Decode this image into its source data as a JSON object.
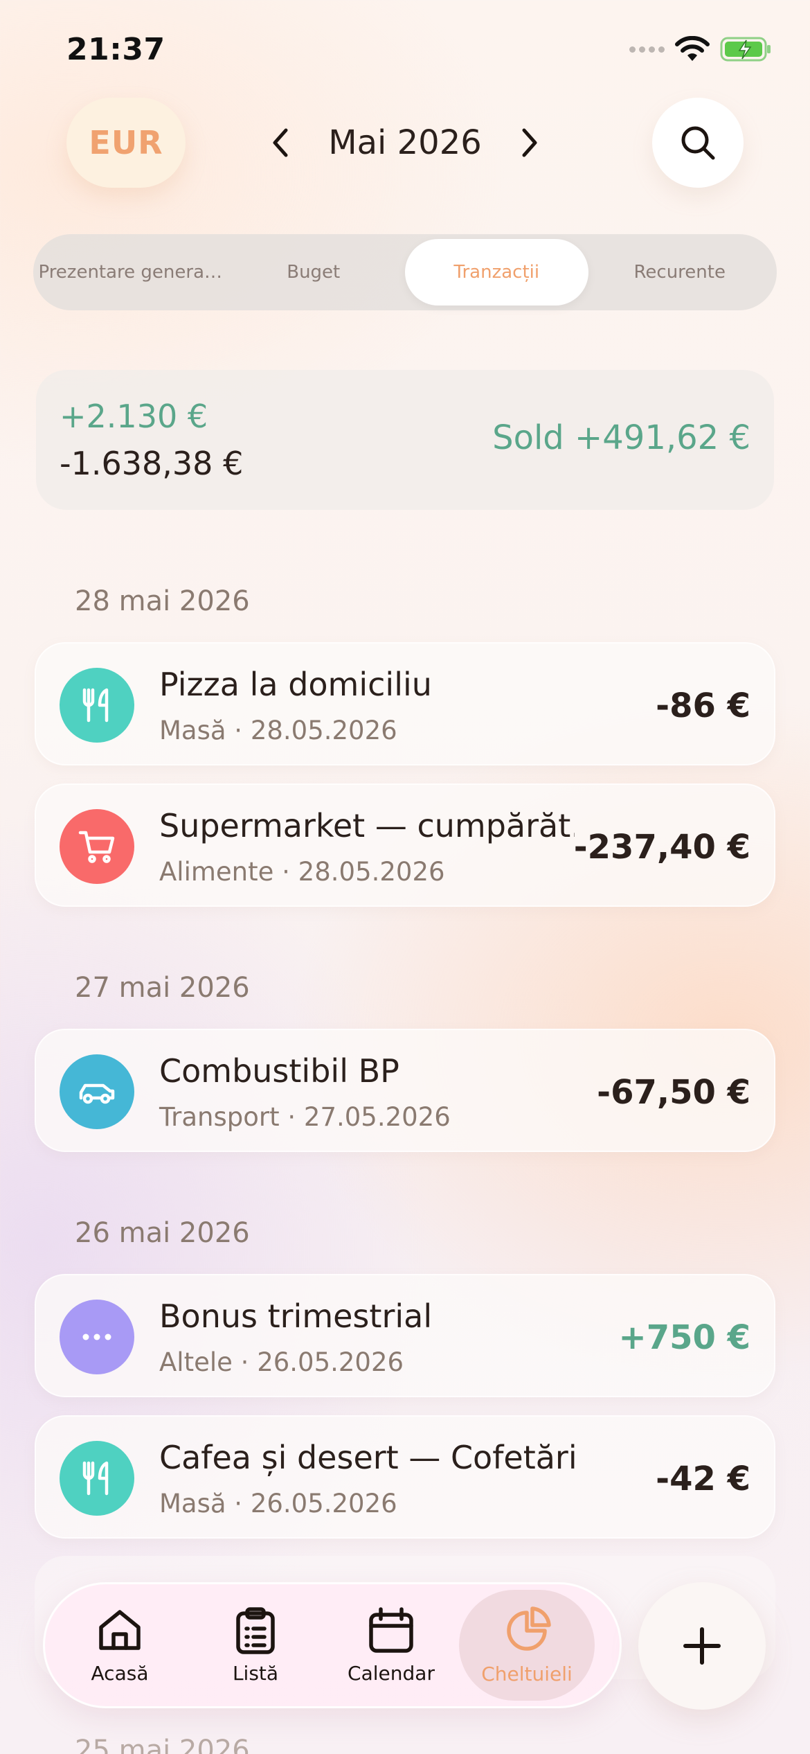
{
  "status_bar": {
    "time": "21:37"
  },
  "header": {
    "currency": "EUR",
    "month": "Mai 2026"
  },
  "tabs": [
    {
      "label": "Prezentare genera…",
      "active": false
    },
    {
      "label": "Buget",
      "active": false
    },
    {
      "label": "Tranzacții",
      "active": true
    },
    {
      "label": "Recurente",
      "active": false
    }
  ],
  "summary": {
    "income": "+2.130 €",
    "expense": "-1.638,38 €",
    "balance": "Sold +491,62 €"
  },
  "groups": [
    {
      "date": "28 mai 2026",
      "transactions": [
        {
          "title": "Pizza la domiciliu",
          "subtitle": "Masă · 28.05.2026",
          "amount": "-86 €",
          "icon": "fork-knife-icon",
          "color": "#4fd1c1"
        },
        {
          "title": "Supermarket — cumpărăt…",
          "subtitle": "Alimente · 28.05.2026",
          "amount": "-237,40 €",
          "icon": "cart-icon",
          "color": "#f96a6a"
        }
      ]
    },
    {
      "date": "27 mai 2026",
      "transactions": [
        {
          "title": "Combustibil BP",
          "subtitle": "Transport · 27.05.2026",
          "amount": "-67,50 €",
          "icon": "car-icon",
          "color": "#45b7d6"
        }
      ]
    },
    {
      "date": "26 mai 2026",
      "transactions": [
        {
          "title": "Bonus trimestrial",
          "subtitle": "Altele · 26.05.2026",
          "amount": "+750 €",
          "icon": "more-dots-icon",
          "color": "#a89af5"
        },
        {
          "title": "Cafea și desert — Cofetărie",
          "subtitle": "Masă · 26.05.2026",
          "amount": "-42 €",
          "icon": "fork-knife-icon",
          "color": "#4fd1c1"
        }
      ]
    }
  ],
  "peek_date": "25 mai 2026",
  "bottom_nav": [
    {
      "label": "Acasă",
      "icon": "home-icon",
      "active": false
    },
    {
      "label": "Listă",
      "icon": "clipboard-list-icon",
      "active": false
    },
    {
      "label": "Calendar",
      "icon": "calendar-icon",
      "active": false
    },
    {
      "label": "Cheltuieli",
      "icon": "pie-chart-icon",
      "active": true
    }
  ],
  "colors": {
    "accent": "#f0a06c",
    "positive": "#5aa68a"
  }
}
